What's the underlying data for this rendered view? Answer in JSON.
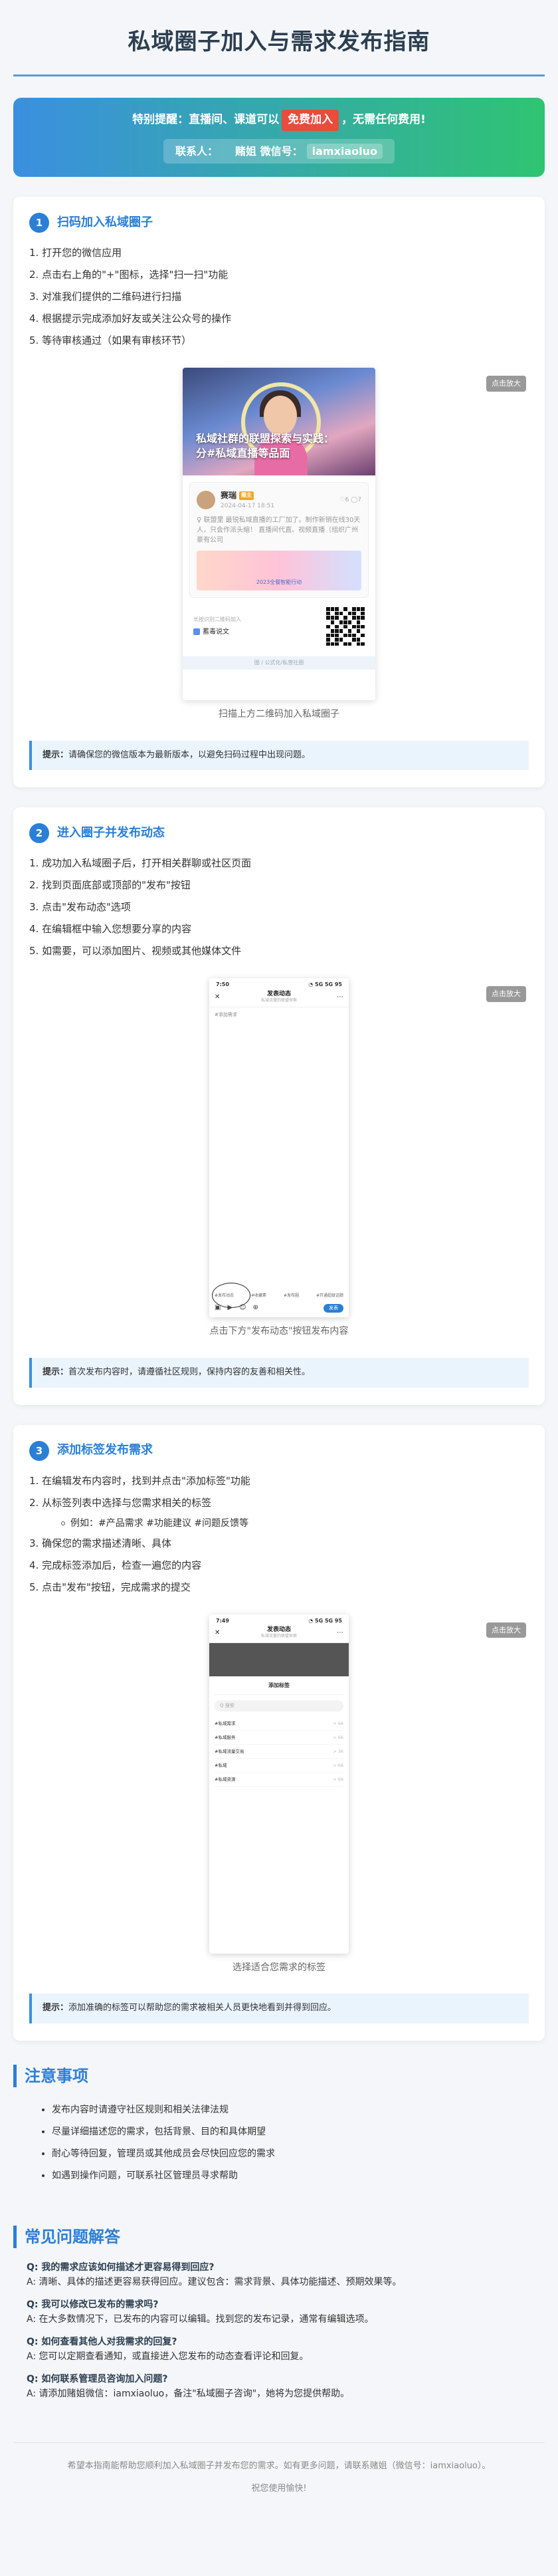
{
  "page_title": "私域圈子加入与需求发布指南",
  "banner": {
    "notice_prefix": "特别提醒：直播间、课道可以",
    "free_badge": "免费加入",
    "notice_suffix": "，无需任何费用!",
    "contact_label": "联系人：",
    "contact_name": "赌姐",
    "wechat_label": "微信号：",
    "wechat_id": "iamxiaoluo"
  },
  "zoom_label": "点击放大",
  "step1": {
    "number": "1",
    "title": "扫码加入私域圈子",
    "items": [
      "1. 打开您的微信应用",
      "2. 点击右上角的\"+\"图标，选择\"扫一扫\"功能",
      "3. 对准我们提供的二维码进行扫描",
      "4. 根据提示完成添加好友或关注公众号的操作",
      "5. 等待审核通过（如果有审核环节）"
    ],
    "caption": "扫描上方二维码加入私域圈子",
    "tip_label": "提示：",
    "tip_text": "请确保您的微信版本为最新版本，以避免扫码过程中出现问题。",
    "screenshot": {
      "headline": "私域社群的联盟探索与实践：分#私域直播等品面",
      "author": "赛瑞",
      "author_tag": "圈主",
      "date": "2024-04-17 18:51",
      "stats": "♡6  ◯7",
      "body_text": "♀ 联盟里 最锐私域直播的工厂加了。制作新销在线30天人，只会作派头缩！ 直播间代直、视频直播（组织广州豪有公司",
      "banner_text": "2023全餐智能行动",
      "qr_note": "长按识别二维码加入",
      "brand": "蓄毒说文",
      "footer_text": "圈 / 公式化/私营社圈"
    }
  },
  "step2": {
    "number": "2",
    "title": "进入圈子并发布动态",
    "items": [
      "1. 成功加入私域圈子后，打开相关群聊或社区页面",
      "2. 找到页面底部或顶部的\"发布\"按钮",
      "3. 点击\"发布动态\"选项",
      "4. 在编辑框中输入您想要分享的内容",
      "5. 如需要，可以添加图片、视频或其他媒体文件"
    ],
    "caption": "点击下方\"发布动态\"按钮发布内容",
    "tip_label": "提示：",
    "tip_text": "首次发布内容时，请遵循社区规则，保持内容的友善和相关性。",
    "screenshot": {
      "time": "7:50",
      "signal": "◔ 5G 5G 95",
      "nav_title": "发表动态",
      "nav_sub": "私域流量的联盟探索",
      "placeholder": "#添加需求",
      "tags": [
        "#发布动态",
        "#收藏素",
        "#发布圈",
        "#开通超级话题"
      ],
      "send": "发表"
    }
  },
  "step3": {
    "number": "3",
    "title": "添加标签发布需求",
    "items": [
      "1. 在编辑发布内容时，找到并点击\"添加标签\"功能",
      "2. 从标签列表中选择与您需求相关的标签",
      "3. 确保您的需求描述清晰、具体",
      "4. 完成标签添加后，检查一遍您的内容",
      "5. 点击\"发布\"按钮，完成需求的提交"
    ],
    "sub_item": "例如：#产品需求 #功能建议 #问题反馈等",
    "caption": "选择适合您需求的标签",
    "tip_label": "提示：",
    "tip_text": "添加准确的标签可以帮助您的需求被相关人员更快地看到并得到回应。",
    "screenshot": {
      "time": "7:49",
      "signal": "◔ 5G 5G 95",
      "nav_title": "发表动态",
      "nav_sub": "私域流量的联盟探索",
      "sheet_title": "添加标签",
      "search": "Q 搜索",
      "tags": [
        [
          "#私域需求",
          "> 66"
        ],
        [
          "#私域服务",
          "> 66"
        ],
        [
          "#私域流量交易",
          "> 36"
        ],
        [
          "#私域",
          "> 66"
        ],
        [
          "#私域资源",
          "> 66"
        ]
      ]
    }
  },
  "notes": {
    "title": "注意事项",
    "items": [
      "发布内容时请遵守社区规则和相关法律法规",
      "尽量详细描述您的需求，包括背景、目的和具体期望",
      "耐心等待回复，管理员或其他成员会尽快回应您的需求",
      "如遇到操作问题，可联系社区管理员寻求帮助"
    ]
  },
  "faq": {
    "title": "常见问题解答",
    "items": [
      {
        "q": "Q: 我的需求应该如何描述才更容易得到回应?",
        "a": "A: 清晰、具体的描述更容易获得回应。建议包含：需求背景、具体功能描述、预期效果等。"
      },
      {
        "q": "Q: 我可以修改已发布的需求吗?",
        "a": "A: 在大多数情况下，已发布的内容可以编辑。找到您的发布记录，通常有编辑选项。"
      },
      {
        "q": "Q: 如何查看其他人对我需求的回复?",
        "a": "A: 您可以定期查看通知，或直接进入您发布的动态查看评论和回复。"
      },
      {
        "q": "Q: 如何联系管理员咨询加入问题?",
        "a": "A: 请添加赌姐微信：iamxiaoluo，备注\"私域圈子咨询\"，她将为您提供帮助。"
      }
    ]
  },
  "footer": {
    "line1": "希望本指南能帮助您顺利加入私域圈子并发布您的需求。如有更多问题，请联系赌姐（微信号：iamxiaoluo）。",
    "line2": "祝您使用愉快!"
  }
}
